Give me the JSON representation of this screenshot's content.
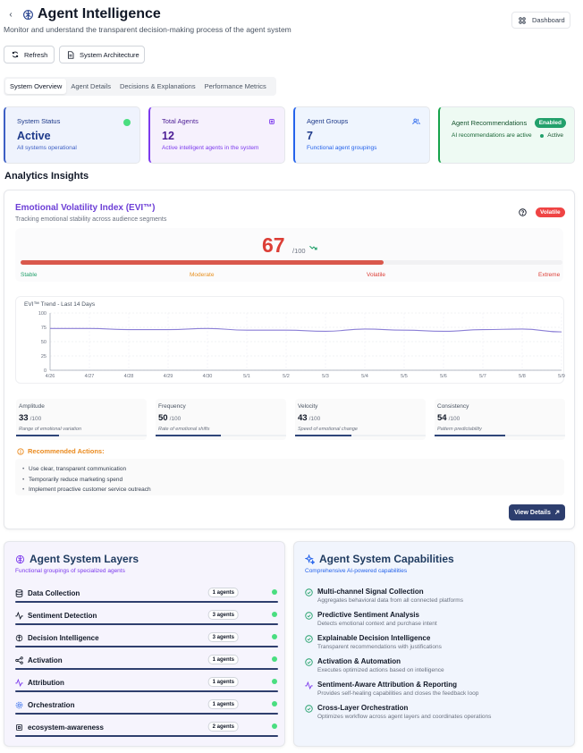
{
  "header": {
    "title": "Agent Intelligence",
    "subtitle": "Monitor and understand the transparent decision-making process of the agent system",
    "dashboard_label": "Dashboard"
  },
  "actions": {
    "refresh_label": "Refresh",
    "architecture_label": "System Architecture"
  },
  "tabs": [
    {
      "label": "System Overview",
      "active": true
    },
    {
      "label": "Agent Details",
      "active": false
    },
    {
      "label": "Decisions & Explanations",
      "active": false
    },
    {
      "label": "Performance Metrics",
      "active": false
    }
  ],
  "stats": {
    "system_status": {
      "label": "System Status",
      "value": "Active",
      "desc": "All systems operational",
      "accent": "#3d5fc4"
    },
    "total_agents": {
      "label": "Total Agents",
      "value": "12",
      "desc": "Active intelligent agents in the system",
      "accent": "#7c3aed"
    },
    "agent_groups": {
      "label": "Agent Groups",
      "value": "7",
      "desc": "Functional agent groupings",
      "accent": "#2563eb"
    },
    "recommendations": {
      "label": "Agent Recommendations",
      "badge": "Enabled",
      "desc": "AI recommendations are active",
      "status": "Active",
      "accent": "#16a34a"
    }
  },
  "analytics": {
    "heading": "Analytics Insights"
  },
  "evi": {
    "title": "Emotional Volatility Index (EVI™)",
    "subtitle": "Tracking emotional stability across audience segments",
    "badge": "Volatile",
    "score": "67",
    "score_max": "/100",
    "score_fraction": 0.67,
    "scale": [
      "Stable",
      "Moderate",
      "Volatile",
      "Extreme"
    ],
    "scale_colors": [
      "#22a06b",
      "#e7901f",
      "#dc3e36",
      "#dc3e36"
    ],
    "metrics": [
      {
        "label": "Amplitude",
        "value": "33",
        "max": "/100",
        "desc": "Range of emotional variation",
        "fraction": 0.33
      },
      {
        "label": "Frequency",
        "value": "50",
        "max": "/100",
        "desc": "Rate of emotional shifts",
        "fraction": 0.5
      },
      {
        "label": "Velocity",
        "value": "43",
        "max": "/100",
        "desc": "Speed of emotional change",
        "fraction": 0.43
      },
      {
        "label": "Consistency",
        "value": "54",
        "max": "/100",
        "desc": "Pattern predictability",
        "fraction": 0.54
      }
    ],
    "recommended_title": "Recommended Actions:",
    "recommended": [
      "Use clear, transparent communication",
      "Temporarily reduce marketing spend",
      "Implement proactive customer service outreach"
    ],
    "view_details": "View Details"
  },
  "chart_data": {
    "type": "line",
    "title": "EVI™ Trend - Last 14 Days",
    "x": [
      "4/26",
      "4/27",
      "4/28",
      "4/29",
      "4/30",
      "5/1",
      "5/2",
      "5/3",
      "5/4",
      "5/5",
      "5/6",
      "5/7",
      "5/8",
      "5/9"
    ],
    "series": [
      {
        "values": [
          73,
          73,
          71,
          71,
          73,
          70,
          70,
          68,
          72,
          70,
          68,
          71,
          72,
          67
        ],
        "color": "#8b7fd6"
      }
    ],
    "ylim": [
      0,
      100
    ],
    "yticks": [
      "0",
      "25",
      "50",
      "75",
      "100"
    ],
    "grid": true
  },
  "layers": {
    "title": "Agent System Layers",
    "subtitle": "Functional groupings of specialized agents",
    "items": [
      {
        "name": "Data Collection",
        "count": "1 agents",
        "icon": "database-icon"
      },
      {
        "name": "Sentiment Detection",
        "count": "3 agents",
        "icon": "activity-icon"
      },
      {
        "name": "Decision Intelligence",
        "count": "3 agents",
        "icon": "brain-icon"
      },
      {
        "name": "Activation",
        "count": "1 agents",
        "icon": "share-icon"
      },
      {
        "name": "Attribution",
        "count": "1 agents",
        "icon": "pulse-icon"
      },
      {
        "name": "Orchestration",
        "count": "1 agents",
        "icon": "settings-icon"
      },
      {
        "name": "ecosystem-awareness",
        "count": "2 agents",
        "icon": "cpu-icon"
      }
    ]
  },
  "capabilities": {
    "title": "Agent System Capabilities",
    "subtitle": "Comprehensive AI-powered capabilities",
    "items": [
      {
        "name": "Multi-channel Signal Collection",
        "desc": "Aggregates behavioral data from all connected platforms",
        "icon": "check-circle-icon"
      },
      {
        "name": "Predictive Sentiment Analysis",
        "desc": "Detects emotional context and purchase intent",
        "icon": "check-circle-icon"
      },
      {
        "name": "Explainable Decision Intelligence",
        "desc": "Transparent recommendations with justifications",
        "icon": "check-circle-icon"
      },
      {
        "name": "Activation & Automation",
        "desc": "Executes optimized actions based on intelligence",
        "icon": "check-circle-icon"
      },
      {
        "name": "Sentiment-Aware Attribution & Reporting",
        "desc": "Provides self-healing capabilities and closes the feedback loop",
        "icon": "pulse-icon"
      },
      {
        "name": "Cross-Layer Orchestration",
        "desc": "Optimizes workflow across agent layers and coordinates operations",
        "icon": "check-circle-icon"
      }
    ]
  }
}
